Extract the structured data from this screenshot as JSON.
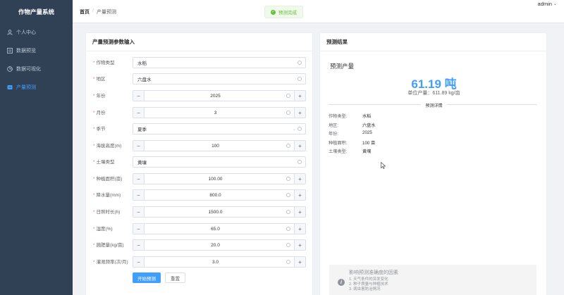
{
  "app": {
    "title": "作物产量系统"
  },
  "sidebar": {
    "items": [
      {
        "label": "个人中心",
        "icon": "user-icon"
      },
      {
        "label": "数据预览",
        "icon": "list-icon"
      },
      {
        "label": "数据可视化",
        "icon": "chart-icon"
      },
      {
        "label": "产量预测",
        "icon": "predict-icon",
        "active": true
      }
    ]
  },
  "header": {
    "breadcrumb_home": "首页",
    "breadcrumb_sep": "/",
    "breadcrumb_current": "产量预测",
    "toast": "预测完成",
    "user": "admin"
  },
  "form": {
    "title": "产量预测参数输入",
    "fields": [
      {
        "label": "作物类型",
        "value": "水稻",
        "kind": "select"
      },
      {
        "label": "地区",
        "value": "六盘水",
        "kind": "select"
      },
      {
        "label": "年份",
        "value": "2025",
        "kind": "number"
      },
      {
        "label": "月份",
        "value": "3",
        "kind": "number"
      },
      {
        "label": "季节",
        "value": "夏季",
        "kind": "select"
      },
      {
        "label": "海拔高度(m)",
        "value": "100",
        "kind": "number"
      },
      {
        "label": "土壤类型",
        "value": "黄壤",
        "kind": "select"
      },
      {
        "label": "种植面积(亩)",
        "value": "100.00",
        "kind": "number"
      },
      {
        "label": "降水量(mm)",
        "value": "800.0",
        "kind": "number"
      },
      {
        "label": "日照时长(h)",
        "value": "1500.0",
        "kind": "number"
      },
      {
        "label": "湿度(%)",
        "value": "65.0",
        "kind": "number"
      },
      {
        "label": "施肥量(kg/亩)",
        "value": "20.0",
        "kind": "number"
      },
      {
        "label": "灌溉频率(次/月)",
        "value": "3.0",
        "kind": "number"
      }
    ],
    "submit_label": "开始预测",
    "reset_label": "重置"
  },
  "result": {
    "title": "预测结果",
    "subtitle": "预测产量",
    "value": "61.19 吨",
    "unit_yield": "单位产量：611.89 kg/亩",
    "details_title": "预测详情",
    "details": [
      {
        "key": "作物类型:",
        "value": "水稻"
      },
      {
        "key": "地区:",
        "value": "六盘水"
      },
      {
        "key": "年份:",
        "value": "2025"
      },
      {
        "key": "种植面积:",
        "value": "100 亩"
      },
      {
        "key": "土壤类型:",
        "value": "黄壤"
      }
    ],
    "info_title": "影响预测准确度的因素",
    "info_tips": [
      "1. 天气条件的突发变化",
      "2. 种子质量与种植技术",
      "3. 病虫害防治情况"
    ]
  },
  "colors": {
    "accent": "#409eff",
    "sidebar": "#304156",
    "success": "#67c23a",
    "required": "#f56c6c"
  }
}
